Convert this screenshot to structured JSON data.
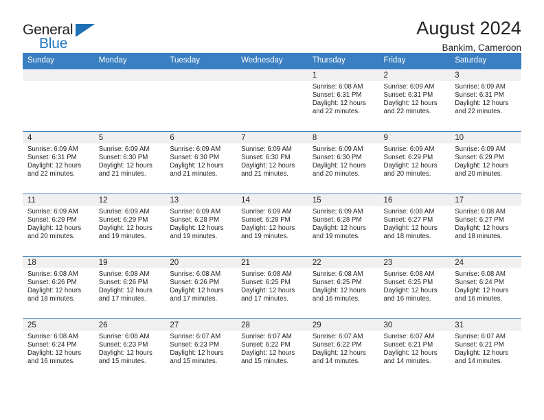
{
  "brand": {
    "name_part1": "General",
    "name_part2": "Blue",
    "accent_color": "#2077c0"
  },
  "header": {
    "title": "August 2024",
    "location": "Bankim, Cameroon"
  },
  "theme": {
    "header_band_color": "#3a7fc1",
    "daynum_band_color": "#f0f0f0",
    "text_color": "#231f20"
  },
  "weekday_headers": [
    "Sunday",
    "Monday",
    "Tuesday",
    "Wednesday",
    "Thursday",
    "Friday",
    "Saturday"
  ],
  "labels": {
    "sunrise_prefix": "Sunrise:",
    "sunset_prefix": "Sunset:",
    "daylight_prefix": "Daylight:"
  },
  "weeks": [
    [
      {
        "day": "",
        "sunrise": "",
        "sunset": "",
        "daylight_line1": "",
        "daylight_line2": "",
        "blank": true
      },
      {
        "day": "",
        "sunrise": "",
        "sunset": "",
        "daylight_line1": "",
        "daylight_line2": "",
        "blank": true
      },
      {
        "day": "",
        "sunrise": "",
        "sunset": "",
        "daylight_line1": "",
        "daylight_line2": "",
        "blank": true
      },
      {
        "day": "",
        "sunrise": "",
        "sunset": "",
        "daylight_line1": "",
        "daylight_line2": "",
        "blank": true
      },
      {
        "day": "1",
        "sunrise": "Sunrise: 6:08 AM",
        "sunset": "Sunset: 6:31 PM",
        "daylight_line1": "Daylight: 12 hours",
        "daylight_line2": "and 22 minutes.",
        "blank": false
      },
      {
        "day": "2",
        "sunrise": "Sunrise: 6:09 AM",
        "sunset": "Sunset: 6:31 PM",
        "daylight_line1": "Daylight: 12 hours",
        "daylight_line2": "and 22 minutes.",
        "blank": false
      },
      {
        "day": "3",
        "sunrise": "Sunrise: 6:09 AM",
        "sunset": "Sunset: 6:31 PM",
        "daylight_line1": "Daylight: 12 hours",
        "daylight_line2": "and 22 minutes.",
        "blank": false
      }
    ],
    [
      {
        "day": "4",
        "sunrise": "Sunrise: 6:09 AM",
        "sunset": "Sunset: 6:31 PM",
        "daylight_line1": "Daylight: 12 hours",
        "daylight_line2": "and 22 minutes.",
        "blank": false
      },
      {
        "day": "5",
        "sunrise": "Sunrise: 6:09 AM",
        "sunset": "Sunset: 6:30 PM",
        "daylight_line1": "Daylight: 12 hours",
        "daylight_line2": "and 21 minutes.",
        "blank": false
      },
      {
        "day": "6",
        "sunrise": "Sunrise: 6:09 AM",
        "sunset": "Sunset: 6:30 PM",
        "daylight_line1": "Daylight: 12 hours",
        "daylight_line2": "and 21 minutes.",
        "blank": false
      },
      {
        "day": "7",
        "sunrise": "Sunrise: 6:09 AM",
        "sunset": "Sunset: 6:30 PM",
        "daylight_line1": "Daylight: 12 hours",
        "daylight_line2": "and 21 minutes.",
        "blank": false
      },
      {
        "day": "8",
        "sunrise": "Sunrise: 6:09 AM",
        "sunset": "Sunset: 6:30 PM",
        "daylight_line1": "Daylight: 12 hours",
        "daylight_line2": "and 20 minutes.",
        "blank": false
      },
      {
        "day": "9",
        "sunrise": "Sunrise: 6:09 AM",
        "sunset": "Sunset: 6:29 PM",
        "daylight_line1": "Daylight: 12 hours",
        "daylight_line2": "and 20 minutes.",
        "blank": false
      },
      {
        "day": "10",
        "sunrise": "Sunrise: 6:09 AM",
        "sunset": "Sunset: 6:29 PM",
        "daylight_line1": "Daylight: 12 hours",
        "daylight_line2": "and 20 minutes.",
        "blank": false
      }
    ],
    [
      {
        "day": "11",
        "sunrise": "Sunrise: 6:09 AM",
        "sunset": "Sunset: 6:29 PM",
        "daylight_line1": "Daylight: 12 hours",
        "daylight_line2": "and 20 minutes.",
        "blank": false
      },
      {
        "day": "12",
        "sunrise": "Sunrise: 6:09 AM",
        "sunset": "Sunset: 6:29 PM",
        "daylight_line1": "Daylight: 12 hours",
        "daylight_line2": "and 19 minutes.",
        "blank": false
      },
      {
        "day": "13",
        "sunrise": "Sunrise: 6:09 AM",
        "sunset": "Sunset: 6:28 PM",
        "daylight_line1": "Daylight: 12 hours",
        "daylight_line2": "and 19 minutes.",
        "blank": false
      },
      {
        "day": "14",
        "sunrise": "Sunrise: 6:09 AM",
        "sunset": "Sunset: 6:28 PM",
        "daylight_line1": "Daylight: 12 hours",
        "daylight_line2": "and 19 minutes.",
        "blank": false
      },
      {
        "day": "15",
        "sunrise": "Sunrise: 6:09 AM",
        "sunset": "Sunset: 6:28 PM",
        "daylight_line1": "Daylight: 12 hours",
        "daylight_line2": "and 19 minutes.",
        "blank": false
      },
      {
        "day": "16",
        "sunrise": "Sunrise: 6:08 AM",
        "sunset": "Sunset: 6:27 PM",
        "daylight_line1": "Daylight: 12 hours",
        "daylight_line2": "and 18 minutes.",
        "blank": false
      },
      {
        "day": "17",
        "sunrise": "Sunrise: 6:08 AM",
        "sunset": "Sunset: 6:27 PM",
        "daylight_line1": "Daylight: 12 hours",
        "daylight_line2": "and 18 minutes.",
        "blank": false
      }
    ],
    [
      {
        "day": "18",
        "sunrise": "Sunrise: 6:08 AM",
        "sunset": "Sunset: 6:26 PM",
        "daylight_line1": "Daylight: 12 hours",
        "daylight_line2": "and 18 minutes.",
        "blank": false
      },
      {
        "day": "19",
        "sunrise": "Sunrise: 6:08 AM",
        "sunset": "Sunset: 6:26 PM",
        "daylight_line1": "Daylight: 12 hours",
        "daylight_line2": "and 17 minutes.",
        "blank": false
      },
      {
        "day": "20",
        "sunrise": "Sunrise: 6:08 AM",
        "sunset": "Sunset: 6:26 PM",
        "daylight_line1": "Daylight: 12 hours",
        "daylight_line2": "and 17 minutes.",
        "blank": false
      },
      {
        "day": "21",
        "sunrise": "Sunrise: 6:08 AM",
        "sunset": "Sunset: 6:25 PM",
        "daylight_line1": "Daylight: 12 hours",
        "daylight_line2": "and 17 minutes.",
        "blank": false
      },
      {
        "day": "22",
        "sunrise": "Sunrise: 6:08 AM",
        "sunset": "Sunset: 6:25 PM",
        "daylight_line1": "Daylight: 12 hours",
        "daylight_line2": "and 16 minutes.",
        "blank": false
      },
      {
        "day": "23",
        "sunrise": "Sunrise: 6:08 AM",
        "sunset": "Sunset: 6:25 PM",
        "daylight_line1": "Daylight: 12 hours",
        "daylight_line2": "and 16 minutes.",
        "blank": false
      },
      {
        "day": "24",
        "sunrise": "Sunrise: 6:08 AM",
        "sunset": "Sunset: 6:24 PM",
        "daylight_line1": "Daylight: 12 hours",
        "daylight_line2": "and 16 minutes.",
        "blank": false
      }
    ],
    [
      {
        "day": "25",
        "sunrise": "Sunrise: 6:08 AM",
        "sunset": "Sunset: 6:24 PM",
        "daylight_line1": "Daylight: 12 hours",
        "daylight_line2": "and 16 minutes.",
        "blank": false
      },
      {
        "day": "26",
        "sunrise": "Sunrise: 6:08 AM",
        "sunset": "Sunset: 6:23 PM",
        "daylight_line1": "Daylight: 12 hours",
        "daylight_line2": "and 15 minutes.",
        "blank": false
      },
      {
        "day": "27",
        "sunrise": "Sunrise: 6:07 AM",
        "sunset": "Sunset: 6:23 PM",
        "daylight_line1": "Daylight: 12 hours",
        "daylight_line2": "and 15 minutes.",
        "blank": false
      },
      {
        "day": "28",
        "sunrise": "Sunrise: 6:07 AM",
        "sunset": "Sunset: 6:22 PM",
        "daylight_line1": "Daylight: 12 hours",
        "daylight_line2": "and 15 minutes.",
        "blank": false
      },
      {
        "day": "29",
        "sunrise": "Sunrise: 6:07 AM",
        "sunset": "Sunset: 6:22 PM",
        "daylight_line1": "Daylight: 12 hours",
        "daylight_line2": "and 14 minutes.",
        "blank": false
      },
      {
        "day": "30",
        "sunrise": "Sunrise: 6:07 AM",
        "sunset": "Sunset: 6:21 PM",
        "daylight_line1": "Daylight: 12 hours",
        "daylight_line2": "and 14 minutes.",
        "blank": false
      },
      {
        "day": "31",
        "sunrise": "Sunrise: 6:07 AM",
        "sunset": "Sunset: 6:21 PM",
        "daylight_line1": "Daylight: 12 hours",
        "daylight_line2": "and 14 minutes.",
        "blank": false
      }
    ]
  ]
}
